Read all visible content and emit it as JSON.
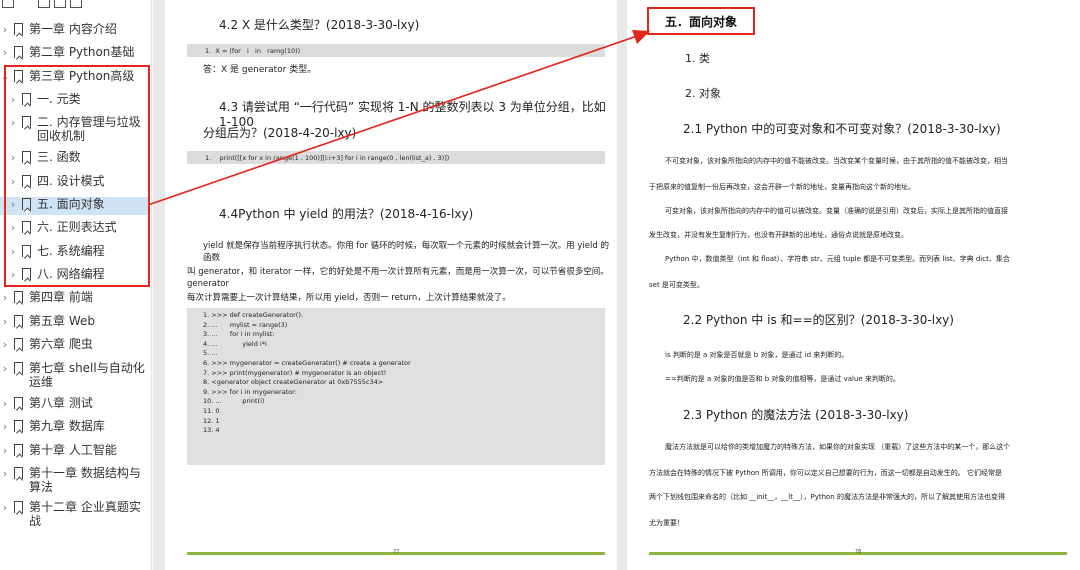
{
  "toc": {
    "items": [
      {
        "label": "第一章 内容介绍",
        "level": 0,
        "expand": false
      },
      {
        "label": "第二章 Python基础",
        "level": 0,
        "expand": false
      },
      {
        "label": "第三章 Python高级",
        "level": 0,
        "expand": true
      },
      {
        "label": "一. 元类",
        "level": 1,
        "expand": false
      },
      {
        "label": "二. 内存管理与垃圾回收机制",
        "level": 1,
        "expand": false
      },
      {
        "label": "三. 函数",
        "level": 1,
        "expand": false
      },
      {
        "label": "四. 设计模式",
        "level": 1,
        "expand": false
      },
      {
        "label": "五. 面向对象",
        "level": 1,
        "expand": false,
        "selected": true
      },
      {
        "label": "六. 正则表达式",
        "level": 1,
        "expand": false
      },
      {
        "label": "七. 系统编程",
        "level": 1,
        "expand": false
      },
      {
        "label": "八. 网络编程",
        "level": 1,
        "expand": false
      },
      {
        "label": "第四章 前端",
        "level": 0,
        "expand": false
      },
      {
        "label": "第五章 Web",
        "level": 0,
        "expand": false
      },
      {
        "label": "第六章 爬虫",
        "level": 0,
        "expand": false
      },
      {
        "label": "第七章 shell与自动化运维",
        "level": 0,
        "expand": false
      },
      {
        "label": "第八章 测试",
        "level": 0,
        "expand": false
      },
      {
        "label": "第九章 数据库",
        "level": 0,
        "expand": false
      },
      {
        "label": "第十章 人工智能",
        "level": 0,
        "expand": false
      },
      {
        "label": "第十一章 数据结构与算法",
        "level": 0,
        "expand": false
      },
      {
        "label": "第十二章 企业真题实战",
        "level": 0,
        "expand": false
      }
    ]
  },
  "left_page": {
    "h_42": "4.2 X 是什么类型？(2018-3-30-lxy)",
    "code_42": "1.  X = (for   i   in   ramg(10))",
    "ans_42": "答：X 是 generator 类型。",
    "h_43_line1": "4.3 请尝试用 “一行代码” 实现将 1-N    的整数列表以  3 为单位分组，比如  1-100",
    "h_43_line2": "分组后为？(2018-4-20-lxy)",
    "code_43": "1.    print([[x for x in range(1 , 100)][i:i+3] for i in range(0 , len(list_a) , 3)])",
    "h_44": "4.4Python 中 yield 的用法？(2018-4-16-lxy)",
    "p_44_l1": "yield 就是保存当前程序执行状态。你用 for 循环的时候，每次取一个元素的时候就会计算一次。用 yield 的函数",
    "p_44_l2": "叫 generator，和 iterator 一样，它的好处是不用一次计算所有元素，而是用一次算一次，可以节省很多空间。generator",
    "p_44_l3": "每次计算需要上一次计算结果，所以用 yield，否则一 return，上次计算结果就没了。",
    "code_44": "1. >>> def createGenerator():\n2. ...      mylist = range(3)\n3. ...      for i in mylist:\n4. ...            yield i*i\n5. ...\n6. >>> mygenerator = createGenerator() # create a generator\n7. >>> print(mygenerator) # mygenerator is an object!\n8. <generator object createGenerator at 0xb7555c34>\n9. >>> for i in mygenerator:\n10. ...          print(i)\n11. 0\n12. 1\n13. 4",
    "page_num": "77"
  },
  "right_page": {
    "section_title": "五．面向对象",
    "s1": "1. 类",
    "s2": "2. 对象",
    "h_21": "2.1 Python 中的可变对象和不可变对象？(2018-3-30-lxy)",
    "p_21_l1": "不可变对象，该对象所指向的内存中的值不能被改变。当改变某个变量时候，由于其所指的值不能被改变，相当",
    "p_21_l2": "于把原来的值复制一份后再改变，这会开辟一个新的地址，变量再指向这个新的地址。",
    "p_21_l3": "可变对象，该对象所指向的内存中的值可以被改变。变量（准确的说是引用）改变后，实际上是其所指的值直接",
    "p_21_l4": "发生改变，并没有发生复制行为，也没有开辟新的出地址，通俗点说就是原地改变。",
    "p_21_l5": "Python 中，数值类型（int 和 float）、字符串 str、元组 tuple 都是不可变类型。而列表 list、字典 dict、集合",
    "p_21_l6": "set 是可变类型。",
    "h_22": "2.2 Python 中 is 和==的区别？(2018-3-30-lxy)",
    "p_22_l1": "is 判断的是 a 对象是否就是 b 对象，是通过 id 来判断的。",
    "p_22_l2": "==判断的是 a 对象的值是否和 b 对象的值相等，是通过 value 来判断的。",
    "h_23": "2.3 Python 的魔法方法  (2018-3-30-lxy)",
    "p_23_l1": "魔法方法就是可以给你的类增加魔力的特殊方法，如果你的对象实现 （重载）了这些方法中的某一个，那么这个",
    "p_23_l2": "方法就会在特殊的情况下被  Python  所调用，你可以定义自己想要的行为，而这一切都是自动发生的。  它们经常是",
    "p_23_l3": "两个下划线包围来命名的（比如  __init__，__lt__），Python  的魔法方法是非常强大的，所以了解其使用方法也变得",
    "p_23_l4": "尤为重要！",
    "page_num": "78"
  },
  "colors": {
    "highlight": "#e3261c",
    "footer": "#8cb43c",
    "selected": "#cfe3f5"
  }
}
